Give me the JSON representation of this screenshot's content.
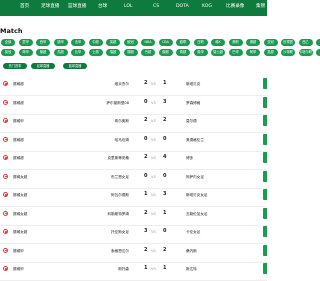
{
  "nav": {
    "items": [
      "首页",
      "足球直播",
      "篮球直播",
      "台球",
      "LOL",
      "CS",
      "DOTA",
      "KOG",
      "比赛录像",
      "集锦"
    ]
  },
  "section": {
    "title": "Match"
  },
  "filters": {
    "row1": [
      "全部",
      "意甲",
      "西甲",
      "德甲",
      "法甲",
      "中超",
      "英超",
      "欧冠",
      "NBA",
      "CBA",
      "欧联",
      "日职",
      "韩K",
      "美职",
      "澳超",
      "亚冠",
      "世预赛",
      "西乙",
      "德乙"
    ],
    "row2": [
      "英冠",
      "荷甲",
      "葡超",
      "苏超",
      "比甲",
      "土超",
      "瑞超",
      "挪超",
      "丹超",
      "俄超",
      "希超",
      "奥甲",
      "瑞士超",
      "巴甲",
      "阿甲",
      "墨超",
      "沙特联",
      "卡塔尔联",
      "其他"
    ]
  },
  "tabs": [
    "热门赛事",
    "足球直播",
    "篮球直播"
  ],
  "matches": [
    {
      "league": "挪威超",
      "home": "维京杰尔",
      "score_home": "2",
      "vs": "VS",
      "score_away": "1",
      "away": "斯塔贝克"
    },
    {
      "league": "挪威超",
      "home": "萨尔普斯堡08",
      "score_home": "0",
      "vs": "VS",
      "score_away": "3",
      "away": "罗森博格"
    },
    {
      "league": "挪威甲",
      "home": "希尔奥斯",
      "score_home": "2",
      "vs": "VS",
      "score_away": "2",
      "away": "莫尔德"
    },
    {
      "league": "挪威超",
      "home": "哈马坎姆",
      "score_home": "0",
      "vs": "VS",
      "score_away": "0",
      "away": "奥德格伦兰"
    },
    {
      "league": "挪威超",
      "home": "克里斯蒂安桑",
      "score_home": "2",
      "vs": "VS",
      "score_away": "4",
      "away": "博多"
    },
    {
      "league": "挪威女超",
      "home": "布兰恩女足",
      "score_home": "0",
      "vs": "VS",
      "score_away": "0",
      "away": "阿萨内女足"
    },
    {
      "league": "挪威女超",
      "home": "阿瓦尔德斯",
      "score_home": "1",
      "vs": "VS",
      "score_away": "3",
      "away": "斯塔贝克女足"
    },
    {
      "league": "挪威女超",
      "home": "利勒斯特罗姆",
      "score_home": "2",
      "vs": "VS",
      "score_away": "1",
      "away": "瓦勒伦加女足"
    },
    {
      "league": "挪威女超",
      "home": "托伦斯女足",
      "score_home": "3",
      "vs": "VS",
      "score_away": "0",
      "away": "卡伦女足"
    },
    {
      "league": "挪威甲",
      "home": "索格恩达尔",
      "score_home": "2",
      "vs": "VS",
      "score_away": "2",
      "away": "桑内斯"
    },
    {
      "league": "挪威甲",
      "home": "斯托森",
      "score_home": "1",
      "vs": "VS",
      "score_away": "1",
      "away": "斯达特"
    }
  ]
}
